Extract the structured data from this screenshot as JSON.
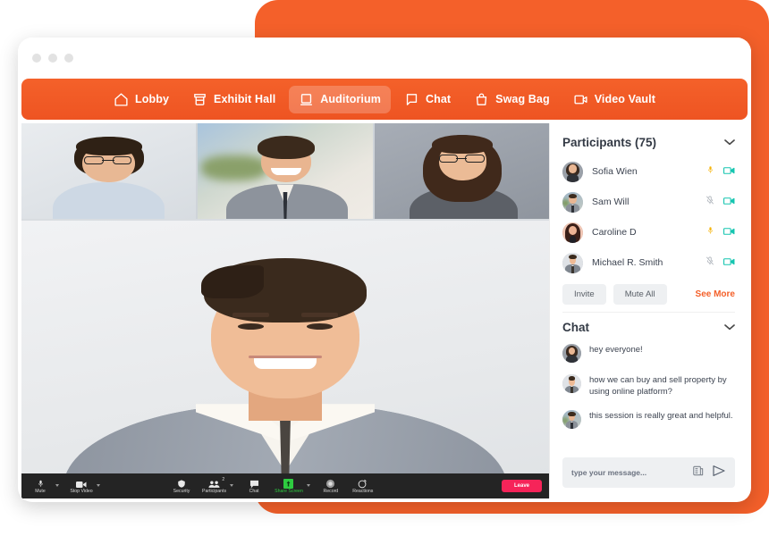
{
  "window": {
    "traffic_lights": [
      "minimize-dot",
      "maximize-dot",
      "close-dot"
    ]
  },
  "colors": {
    "brand_orange": "#F4602A",
    "nav_gradient_top": "#F4612A",
    "nav_gradient_bottom": "#EE5422",
    "leave_red": "#F62459",
    "share_screen_green": "#2ECC40",
    "mic_active": "#F5B40B",
    "mic_muted": "#9aa0a6",
    "camera_teal": "#15C5B0",
    "see_more": "#F4602A"
  },
  "nav": {
    "items": [
      {
        "label": "Lobby",
        "icon": "home-icon",
        "active": false
      },
      {
        "label": "Exhibit Hall",
        "icon": "storefront-icon",
        "active": false
      },
      {
        "label": "Auditorium",
        "icon": "laptop-icon",
        "active": true
      },
      {
        "label": "Chat",
        "icon": "chat-bubble-icon",
        "active": false
      },
      {
        "label": "Swag Bag",
        "icon": "shopping-bag-icon",
        "active": false
      },
      {
        "label": "Video Vault",
        "icon": "video-camera-icon",
        "active": false
      }
    ]
  },
  "stage": {
    "thumbnails": [
      {
        "name": "participant-thumb-1"
      },
      {
        "name": "participant-thumb-2"
      },
      {
        "name": "participant-thumb-3"
      }
    ],
    "main_speaker": "active-speaker-video"
  },
  "toolbar": {
    "left": [
      {
        "label": "Mute",
        "icon": "microphone-icon",
        "has_caret": true
      },
      {
        "label": "Stop Video",
        "icon": "video-camera-icon",
        "has_caret": true
      }
    ],
    "middle": [
      {
        "label": "Security",
        "icon": "shield-icon",
        "has_caret": false,
        "badge": ""
      },
      {
        "label": "Participants",
        "icon": "people-icon",
        "has_caret": true,
        "badge": "2"
      },
      {
        "label": "Chat",
        "icon": "chat-bubble-icon",
        "has_caret": false,
        "badge": ""
      },
      {
        "label": "Share Screen",
        "icon": "share-screen-icon",
        "has_caret": true,
        "badge": ""
      },
      {
        "label": "Record",
        "icon": "record-icon",
        "has_caret": false,
        "badge": ""
      },
      {
        "label": "Reactions",
        "icon": "reactions-icon",
        "has_caret": false,
        "badge": ""
      }
    ],
    "leave_label": "Leave"
  },
  "participants": {
    "title": "Participants (75)",
    "collapse_icon": "chevron-down-icon",
    "rows": [
      {
        "name": "Sofia Wien",
        "mic": "unmuted",
        "camera": "on",
        "avatar": "woman-dark-hair"
      },
      {
        "name": "Sam Will",
        "mic": "muted",
        "camera": "on",
        "avatar": "man-suit-outdoor"
      },
      {
        "name": "Caroline D",
        "mic": "unmuted",
        "camera": "on",
        "avatar": "woman-long-hair"
      },
      {
        "name": "Michael R. Smith",
        "mic": "muted",
        "camera": "on",
        "avatar": "man-suit-tie"
      }
    ],
    "actions": {
      "invite": "Invite",
      "mute_all": "Mute All",
      "see_more": "See More"
    }
  },
  "chat": {
    "title": "Chat",
    "collapse_icon": "chevron-down-icon",
    "messages": [
      {
        "text": "hey everyone!",
        "avatar": "woman-dark-hair"
      },
      {
        "text": "how we can buy and  sell property by using online platform?",
        "avatar": "man-suit-tie"
      },
      {
        "text": "this session is really great and helpful.",
        "avatar": "man-suit-outdoor"
      }
    ],
    "composer": {
      "placeholder": "type your message...",
      "value": "",
      "attach_icon": "document-attach-icon",
      "send_icon": "send-arrow-icon"
    }
  }
}
